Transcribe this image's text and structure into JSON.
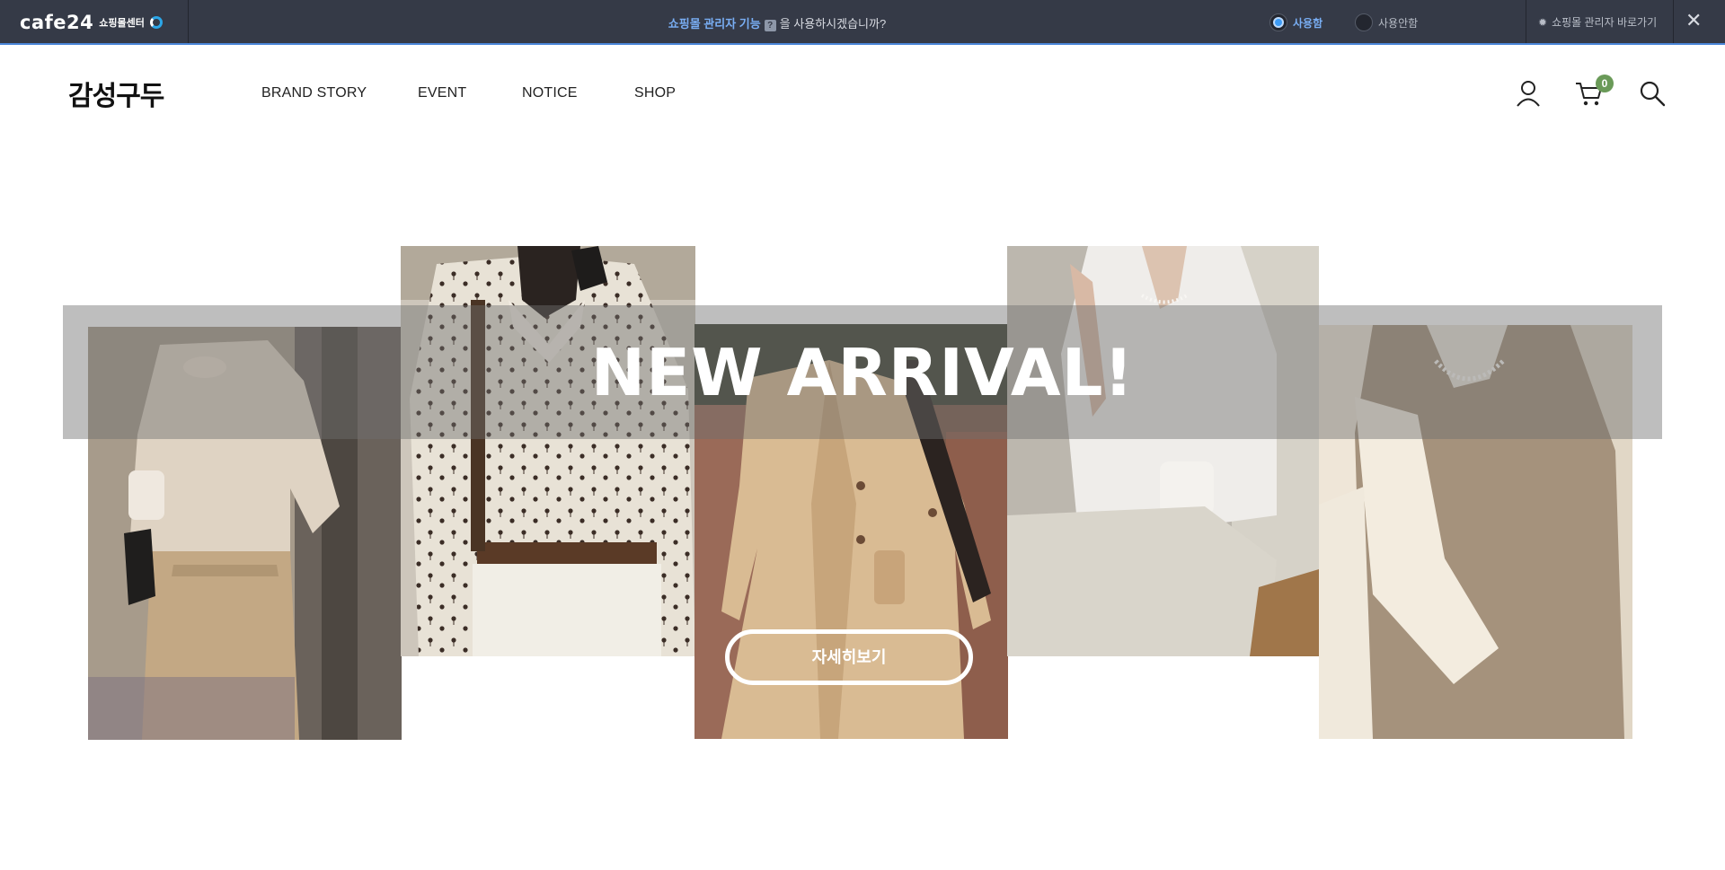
{
  "admin_bar": {
    "logo_text": "cafe24",
    "logo_sub": "쇼핑몰센터",
    "question_highlight": "쇼핑몰 관리자 기능",
    "help_mark": "?",
    "question_rest": "을 사용하시겠습니까?",
    "option_use": "사용함",
    "option_not_use": "사용안함",
    "selected": "사용함",
    "shortcut_label": "쇼핑몰 관리자 바로가기",
    "close_symbol": "✕"
  },
  "header": {
    "logo": "감성구두",
    "nav": [
      "BRAND STORY",
      "EVENT",
      "NOTICE",
      "SHOP"
    ],
    "icons": [
      "user-icon",
      "cart-icon",
      "search-icon"
    ],
    "cart_count": "0"
  },
  "hero": {
    "title": "NEW ARRIVAL!",
    "button_label": "자세히보기",
    "photos": [
      "beige-tshirt-photo",
      "floral-blouse-photo",
      "trench-coat-photo",
      "white-puff-sleeve-photo",
      "knit-vest-photo"
    ]
  },
  "colors": {
    "admin_bg": "#353a47",
    "admin_accent": "#79aef4",
    "cart_badge": "#6a9a58"
  }
}
